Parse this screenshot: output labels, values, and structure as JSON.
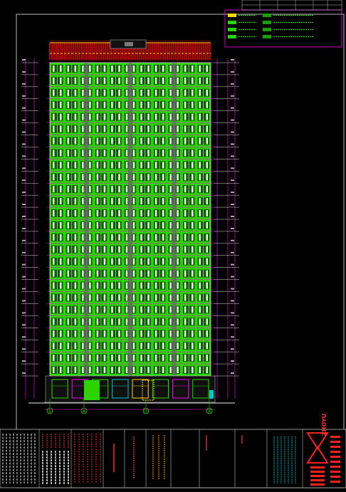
{
  "drawing": {
    "colors": {
      "background": "#000000",
      "frame": "#c8c8c8",
      "facade_green": "#2bd400",
      "window_white": "#e8ffe8",
      "grid_magenta": "#ff00ff",
      "roof_red": "#e00000",
      "roof_yellow": "#ffd800",
      "title_cyan": "#00c8c8",
      "logo_red": "#ff2020"
    },
    "floors": 26,
    "window_columns": 11,
    "grid_bubbles": [
      "①",
      "⑨",
      "⑮",
      "⑱"
    ],
    "legend": {
      "rows": 4,
      "swatch_colors": [
        "#ffd800",
        "#2bd400",
        "#2bd400",
        "#2bd400",
        "#1a9e00",
        "#1a9e00",
        "#1a9e00",
        "#1a9e00"
      ]
    },
    "title_block": {
      "company_logo_text": "ZHOYU",
      "company_cn_text": "浙宇建筑",
      "icon": "company-logo-icon"
    }
  }
}
